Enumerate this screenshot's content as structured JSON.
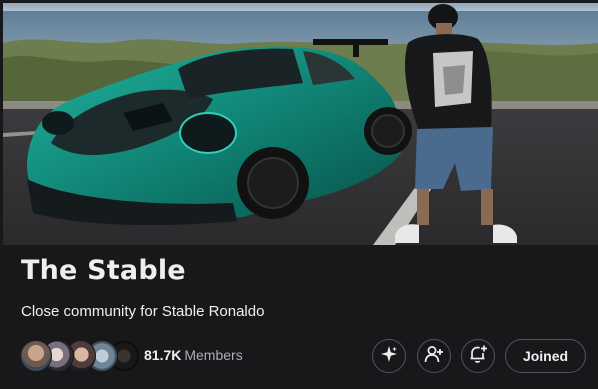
{
  "community": {
    "name": "The Stable",
    "description": "Close community for Stable Ronaldo",
    "member_count": "81.7K",
    "member_label": "Members"
  },
  "members_preview": {
    "avatars": [
      "member-avatar-1",
      "member-avatar-2",
      "member-avatar-3",
      "member-avatar-4",
      "member-avatar-5"
    ]
  },
  "actions": {
    "sparkle_icon": "sparkle-icon",
    "invite_icon": "add-user-icon",
    "notify_icon": "bell-plus-icon",
    "joined_label": "Joined"
  },
  "colors": {
    "background": "#18181b",
    "text": "#efeff1",
    "muted_text": "#adadb8",
    "button_border": "#53535f"
  }
}
